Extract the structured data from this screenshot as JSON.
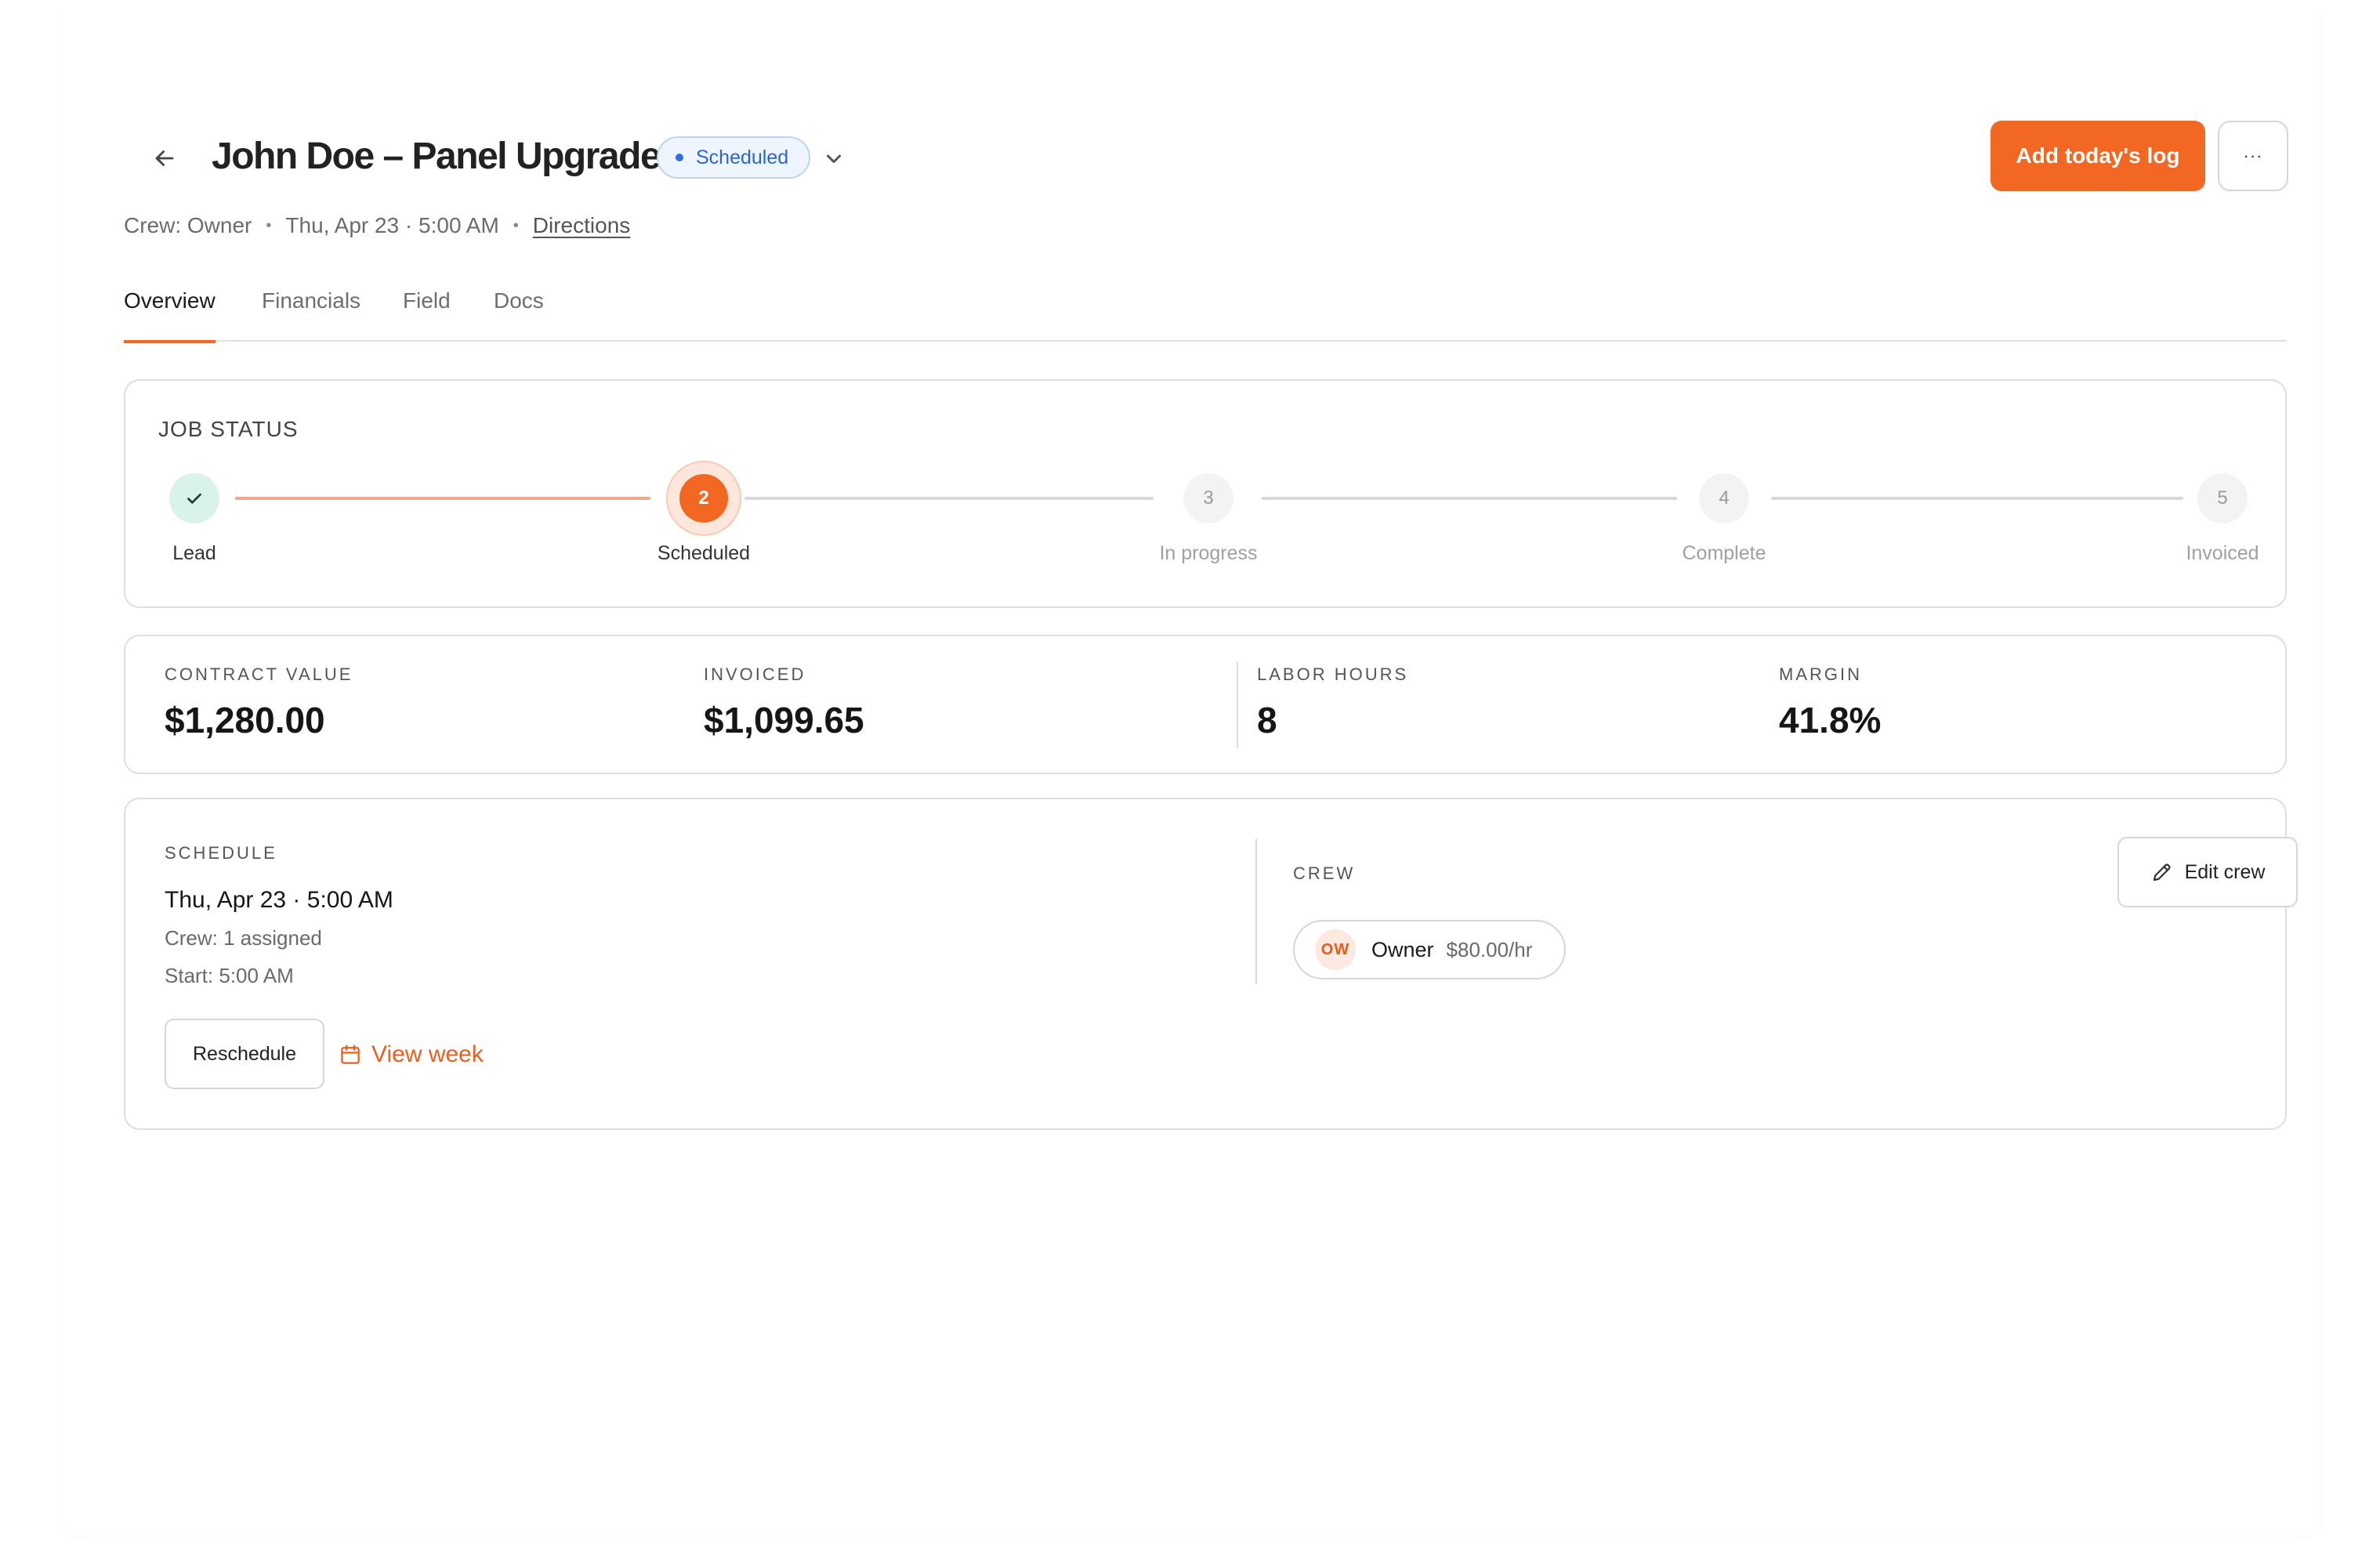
{
  "header": {
    "title": "John Doe – Panel Upgrade",
    "status": "Scheduled",
    "back_icon": "arrow-left-icon",
    "primary_action": "Add today's log",
    "more_label": "···"
  },
  "meta": {
    "crew": "Crew: Owner",
    "datetime": "Thu, Apr 23 · 5:00 AM",
    "directions": "Directions",
    "separator": "•"
  },
  "tabs": [
    {
      "label": "Overview",
      "active": true
    },
    {
      "label": "Financials",
      "active": false
    },
    {
      "label": "Field",
      "active": false
    },
    {
      "label": "Docs",
      "active": false
    }
  ],
  "job_status": {
    "label": "JOB STATUS",
    "steps": [
      {
        "number": "1",
        "label": "Lead",
        "state": "done"
      },
      {
        "number": "2",
        "label": "Scheduled",
        "state": "current"
      },
      {
        "number": "3",
        "label": "In progress",
        "state": "pending"
      },
      {
        "number": "4",
        "label": "Complete",
        "state": "pending"
      },
      {
        "number": "5",
        "label": "Invoiced",
        "state": "pending"
      }
    ]
  },
  "metrics": [
    {
      "label": "CONTRACT VALUE",
      "value": "$1,280.00"
    },
    {
      "label": "INVOICED",
      "value": "$1,099.65"
    },
    {
      "label": "LABOR HOURS",
      "value": "8"
    },
    {
      "label": "MARGIN",
      "value": "41.8%"
    }
  ],
  "schedule": {
    "label": "SCHEDULE",
    "date": "Thu, Apr 23 · 5:00 AM",
    "crew": "Crew: 1 assigned",
    "start": "Start: 5:00 AM",
    "reschedule": "Reschedule",
    "view_week": "View week"
  },
  "crew": {
    "label": "CREW",
    "edit": "Edit crew",
    "members": [
      {
        "initials": "OW",
        "name": "Owner",
        "rate": "$80.00/hr"
      }
    ]
  },
  "colors": {
    "accent": "#f26722",
    "status_blue": "#2f64c8",
    "done_green": "#d9f3e8"
  }
}
